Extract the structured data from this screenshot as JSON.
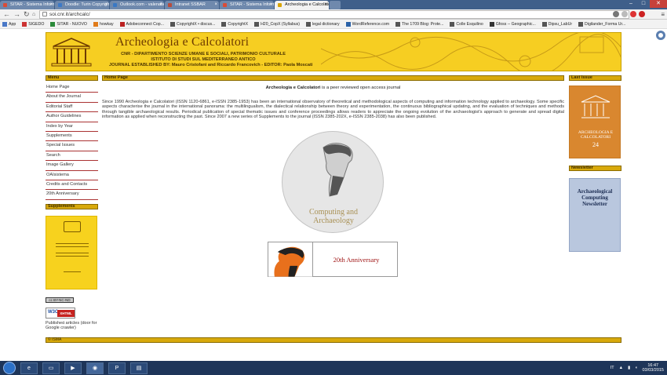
{
  "browser": {
    "tabs": [
      {
        "label": "SITAR - Sistema Informat...",
        "active": false,
        "color": "#d94c38"
      },
      {
        "label": "Doodle: Turin Copyright...",
        "active": false,
        "color": "#3d79c7"
      },
      {
        "label": "Outlook.com - valenabo...",
        "active": false,
        "color": "#3a78c4"
      },
      {
        "label": "Intranet SSBAR",
        "active": false,
        "color": "#b84c3c"
      },
      {
        "label": "SITAR - Sistema Informat...",
        "active": false,
        "color": "#d94c38"
      },
      {
        "label": "Archeologia e Calcolator...",
        "active": true,
        "color": "#d9a400"
      }
    ],
    "url": "soi.cnr.it/archcalc/",
    "bookmarks": [
      {
        "label": "App"
      },
      {
        "label": "SIGEDO"
      },
      {
        "label": "SITAR - NUOVO"
      },
      {
        "label": "howkay"
      },
      {
        "label": "Adobeconnect Cop..."
      },
      {
        "label": "CopyrightX • discus..."
      },
      {
        "label": "CopyrightX"
      },
      {
        "label": "H20_CopX (Syllabus)"
      },
      {
        "label": "legal dictionary"
      },
      {
        "label": "WordReference.com"
      },
      {
        "label": "The 1709 Blog: Prote..."
      },
      {
        "label": "Colle Esquilino"
      },
      {
        "label": "Gfoss -- Geographic..."
      },
      {
        "label": "Dipsu_LabUr"
      },
      {
        "label": "Digilander_Forma Ur..."
      }
    ]
  },
  "header": {
    "title": "Archeologia e Calcolatori",
    "line1": "CNR - DIPARTIMENTO SCIENZE UMANE E SOCIALI, PATRIMONIO CULTURALE",
    "line2": "ISTITUTO DI STUDI SUL MEDITERRANEO ANTICO",
    "line3": "JOURNAL ESTABLISHED BY: Mauro Cristofani and Riccardo Francovich - EDITOR: Paola Moscati"
  },
  "left": {
    "menu_head": "Menu",
    "items": [
      "Home Page",
      "About the Journal",
      "Editorial Staff",
      "Author Guidelines",
      "Index by Year",
      "Supplements",
      "Special Issues",
      "Search",
      "Image Gallery",
      "OAIsistema",
      "Credits and Contacts",
      "20th Anniversary"
    ],
    "supp_head": "Supplements",
    "cc_label": "cc BY-NC-ND",
    "w3c_left": "W3C",
    "w3c_right": "XHTML 1.0 ✓",
    "published": "Published articles (door for Google crawler)"
  },
  "main": {
    "head": "Home Page",
    "intro_bold": "Archeologia e Calcolatori",
    "intro_rest": " is a peer reviewed open access journal",
    "paragraph": "Since 1990 Archeologia e Calcolatori (ISSN 1120-6861, e-ISSN 2385-1953) has been an international observatory of theoretical and methodological aspects of computing and information technology applied to archaeology. Some specific aspects characterise the journal in the international panorama: the multilingualism, the dialectical relationship between theory and experimentation, the continuous bibliographical updating, and the evaluation of techniques and methods through tangible archaeological results. Periodical publication of special thematic issues and conference proceedings allows readers to appreciate the ongoing evolution of the archaeologist's approach to generate and spread digital information as applied when reconstructing the past. Since 2007 a new series of Supplements to the journal (ISSN 2385-202X, e-ISSN 2385-2038) has also been published.",
    "logo_line1": "Computing and",
    "logo_line2": "Archaeology",
    "anniversary": "20th Anniversary"
  },
  "right": {
    "last_head": "Last Issue",
    "cover_title": "ARCHEOLOGIA E CALCOLATORI",
    "cover_number": "24",
    "news_head": "Newsletter",
    "news_title": "Archaeological Computing Newsletter"
  },
  "footer": "© ISMA",
  "taskbar": {
    "lang": "IT",
    "time": "16:47",
    "date": "03/03/2015"
  }
}
